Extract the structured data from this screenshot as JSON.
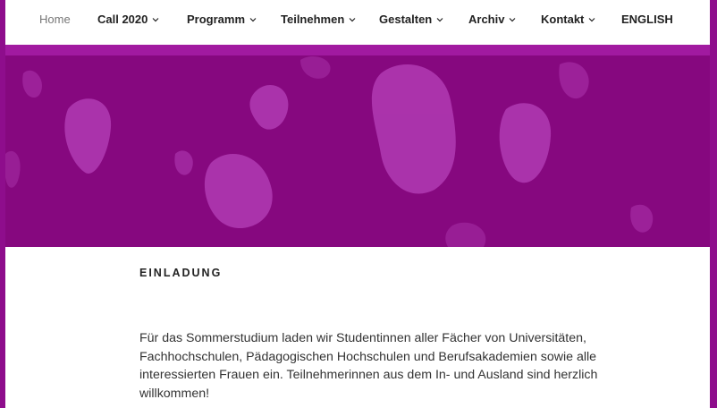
{
  "nav": {
    "items": [
      {
        "label": "Home",
        "has_dropdown": false,
        "active": true
      },
      {
        "label": "Call 2020",
        "has_dropdown": true
      },
      {
        "label": "Programm",
        "has_dropdown": true
      },
      {
        "label": "Teilnehmen",
        "has_dropdown": true
      },
      {
        "label": "Gestalten",
        "has_dropdown": true
      },
      {
        "label": "Archiv",
        "has_dropdown": true
      },
      {
        "label": "Kontakt",
        "has_dropdown": true
      },
      {
        "label": "ENGLISH",
        "has_dropdown": false
      }
    ]
  },
  "colors": {
    "page_background": "#8e0d8c",
    "hero_background": "#86087f",
    "hero_blobs": "#b13bb3",
    "text": "#333333"
  },
  "page": {
    "title": "EINLADUNG",
    "intro": "Für das Sommerstudium laden wir Studentinnen aller Fächer von Universitäten, Fachhochschulen, Pädagogischen Hochschulen und Berufsakademien sowie alle interessierten Frauen ein. Teilnehmerinnen aus dem In- und Ausland sind herzlich willkommen!"
  }
}
